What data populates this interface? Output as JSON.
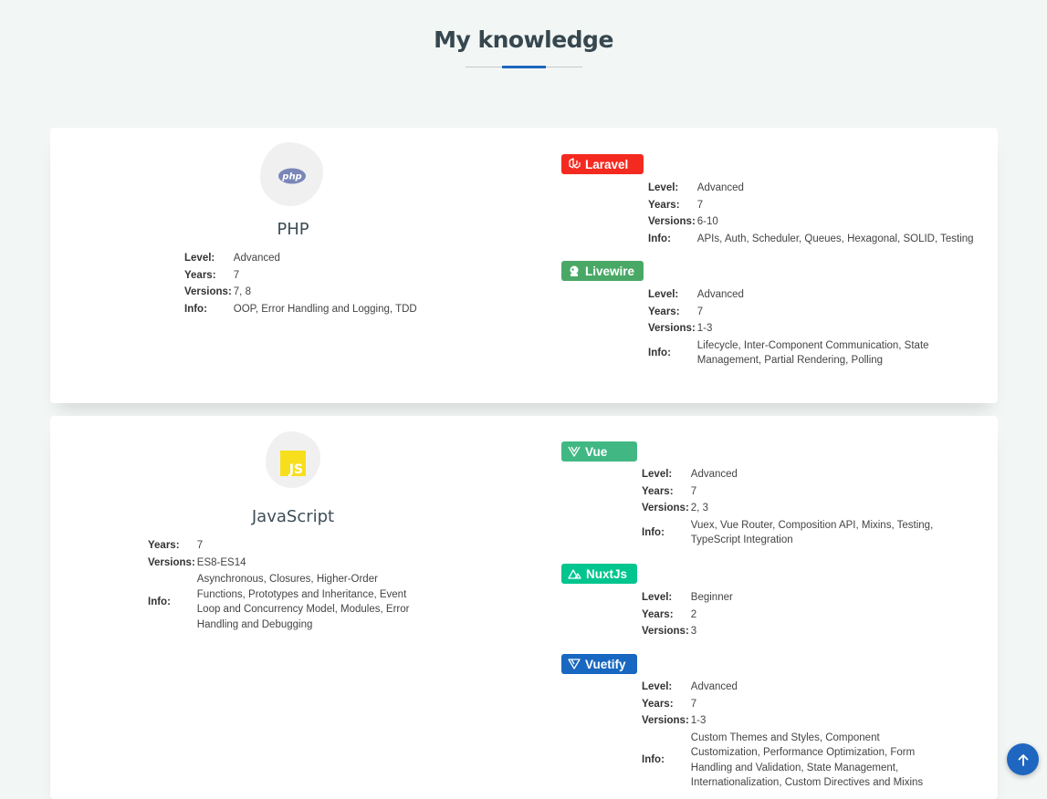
{
  "header": {
    "title": "My knowledge"
  },
  "colors": {
    "accent": "#1e66c0",
    "laravel": "#f42a20",
    "livewire": "#4aa867",
    "vue": "#41b883",
    "nuxt": "#00c58e",
    "vuetify": "#1867c0"
  },
  "php": {
    "name": "PHP",
    "logo_text": "php",
    "rows": [
      {
        "key": "Level:",
        "value": "Advanced"
      },
      {
        "key": "Years:",
        "value": "7"
      },
      {
        "key": "Versions:",
        "value": "7, 8"
      },
      {
        "key": "Info:",
        "value": "OOP, Error Handling and Logging, TDD"
      }
    ],
    "frameworks": [
      {
        "name": "Laravel",
        "rows": [
          {
            "key": "Level:",
            "value": "Advanced"
          },
          {
            "key": "Years:",
            "value": "7"
          },
          {
            "key": "Versions:",
            "value": "6-10"
          },
          {
            "key": "Info:",
            "value": "APIs, Auth, Scheduler, Queues, Hexagonal, SOLID, Testing"
          }
        ]
      },
      {
        "name": "Livewire",
        "rows": [
          {
            "key": "Level:",
            "value": "Advanced"
          },
          {
            "key": "Years:",
            "value": "7"
          },
          {
            "key": "Versions:",
            "value": "1-3"
          },
          {
            "key": "Info:",
            "value": "Lifecycle, Inter-Component Communication, State Management, Partial Rendering, Polling"
          }
        ]
      }
    ]
  },
  "js": {
    "name": "JavaScript",
    "logo_text": "JS",
    "rows": [
      {
        "key": "Years:",
        "value": "7"
      },
      {
        "key": "Versions:",
        "value": "ES8-ES14"
      },
      {
        "key": "Info:",
        "value": "Asynchronous, Closures, Higher-Order Functions, Prototypes and Inheritance, Event Loop and Concurrency Model, Modules, Error Handling and Debugging"
      }
    ],
    "frameworks": [
      {
        "name": "Vue",
        "rows": [
          {
            "key": "Level:",
            "value": "Advanced"
          },
          {
            "key": "Years:",
            "value": "7"
          },
          {
            "key": "Versions:",
            "value": "2, 3"
          },
          {
            "key": "Info:",
            "value": "Vuex, Vue Router, Composition API, Mixins, Testing, TypeScript Integration"
          }
        ]
      },
      {
        "name": "NuxtJs",
        "rows": [
          {
            "key": "Level:",
            "value": "Beginner"
          },
          {
            "key": "Years:",
            "value": "2"
          },
          {
            "key": "Versions:",
            "value": "3"
          }
        ]
      },
      {
        "name": "Vuetify",
        "rows": [
          {
            "key": "Level:",
            "value": "Advanced"
          },
          {
            "key": "Years:",
            "value": "7"
          },
          {
            "key": "Versions:",
            "value": "1-3"
          },
          {
            "key": "Info:",
            "value": "Custom Themes and Styles, Component Customization, Performance Optimization, Form Handling and Validation, State Management, Internationalization, Custom Directives and Mixins"
          }
        ]
      }
    ]
  }
}
